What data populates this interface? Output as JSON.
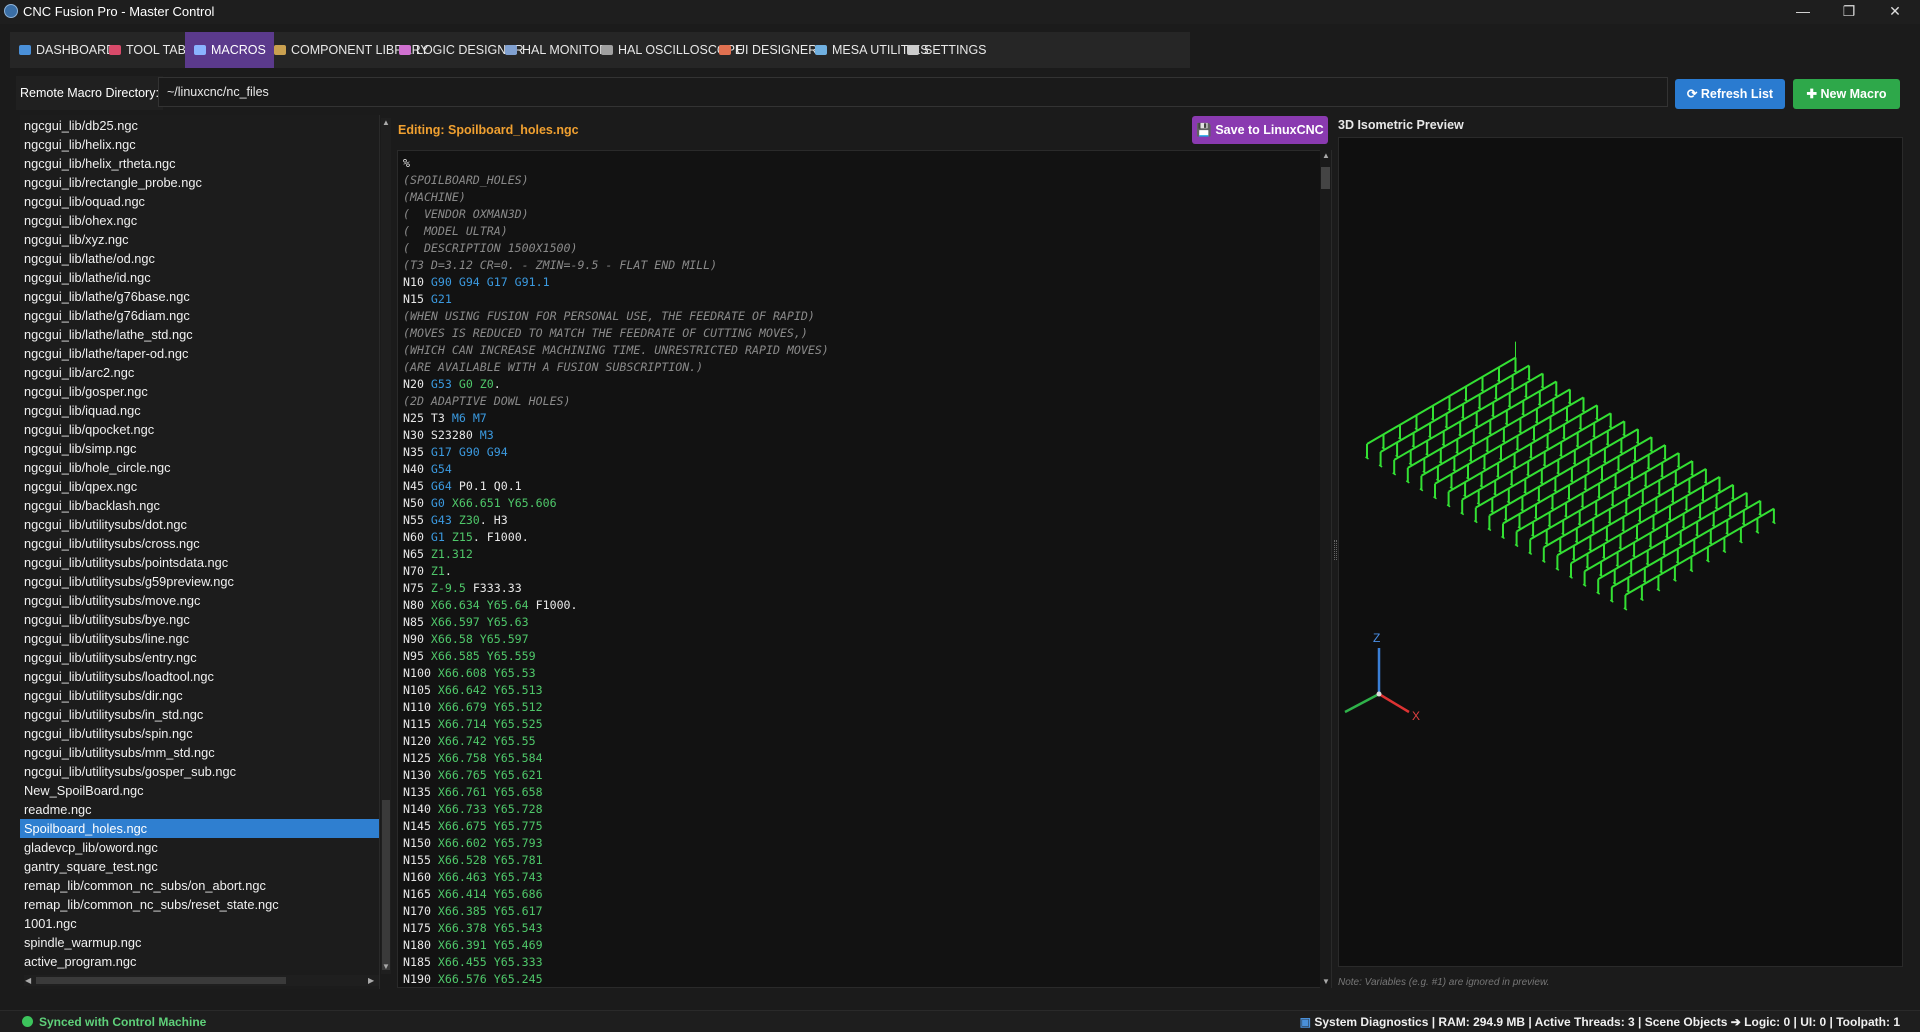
{
  "window": {
    "title": "CNC Fusion Pro - Master Control",
    "minimize": "—",
    "restore": "❐",
    "close": "✕"
  },
  "tabs": [
    {
      "label": "DASHBOARD",
      "icon": "monitor-icon",
      "color": "#4a90d9"
    },
    {
      "label": "TOOL TABLE",
      "icon": "toolbox-icon",
      "color": "#d94a6a"
    },
    {
      "label": "MACROS",
      "icon": "document-icon",
      "color": "#8ab4ff",
      "active": true
    },
    {
      "label": "COMPONENT LIBRARY",
      "icon": "books-icon",
      "color": "#c9a050"
    },
    {
      "label": "LOGIC DESIGNER",
      "icon": "wand-icon",
      "color": "#d070d0"
    },
    {
      "label": "HAL MONITOR",
      "icon": "magnifier-icon",
      "color": "#80a0d0"
    },
    {
      "label": "HAL OSCILLOSCOPE",
      "icon": "chart-icon",
      "color": "#a0a0a0"
    },
    {
      "label": "UI DESIGNER",
      "icon": "palette-icon",
      "color": "#e07050"
    },
    {
      "label": "MESA UTILITIES",
      "icon": "chip-icon",
      "color": "#70b0e0"
    },
    {
      "label": "SETTINGS",
      "icon": "gear-icon",
      "color": "#cccccc"
    }
  ],
  "directory": {
    "label": "Remote Macro Directory:",
    "value": "~/linuxcnc/nc_files",
    "refresh_label": "Refresh List",
    "new_macro_label": "New Macro"
  },
  "files": [
    "ngcgui_lib/db25.ngc",
    "ngcgui_lib/helix.ngc",
    "ngcgui_lib/helix_rtheta.ngc",
    "ngcgui_lib/rectangle_probe.ngc",
    "ngcgui_lib/oquad.ngc",
    "ngcgui_lib/ohex.ngc",
    "ngcgui_lib/xyz.ngc",
    "ngcgui_lib/lathe/od.ngc",
    "ngcgui_lib/lathe/id.ngc",
    "ngcgui_lib/lathe/g76base.ngc",
    "ngcgui_lib/lathe/g76diam.ngc",
    "ngcgui_lib/lathe/lathe_std.ngc",
    "ngcgui_lib/lathe/taper-od.ngc",
    "ngcgui_lib/arc2.ngc",
    "ngcgui_lib/gosper.ngc",
    "ngcgui_lib/iquad.ngc",
    "ngcgui_lib/qpocket.ngc",
    "ngcgui_lib/simp.ngc",
    "ngcgui_lib/hole_circle.ngc",
    "ngcgui_lib/qpex.ngc",
    "ngcgui_lib/backlash.ngc",
    "ngcgui_lib/utilitysubs/dot.ngc",
    "ngcgui_lib/utilitysubs/cross.ngc",
    "ngcgui_lib/utilitysubs/pointsdata.ngc",
    "ngcgui_lib/utilitysubs/g59preview.ngc",
    "ngcgui_lib/utilitysubs/move.ngc",
    "ngcgui_lib/utilitysubs/bye.ngc",
    "ngcgui_lib/utilitysubs/line.ngc",
    "ngcgui_lib/utilitysubs/entry.ngc",
    "ngcgui_lib/utilitysubs/loadtool.ngc",
    "ngcgui_lib/utilitysubs/dir.ngc",
    "ngcgui_lib/utilitysubs/in_std.ngc",
    "ngcgui_lib/utilitysubs/spin.ngc",
    "ngcgui_lib/utilitysubs/mm_std.ngc",
    "ngcgui_lib/utilitysubs/gosper_sub.ngc",
    "New_SpoilBoard.ngc",
    "readme.ngc",
    "Spoilboard_holes.ngc",
    "gladevcp_lib/oword.ngc",
    "gantry_square_test.ngc",
    "remap_lib/common_nc_subs/on_abort.ngc",
    "remap_lib/common_nc_subs/reset_state.ngc",
    "1001.ngc",
    "spindle_warmup.ngc",
    "active_program.ngc"
  ],
  "selected_file": "Spoilboard_holes.ngc",
  "editor": {
    "title": "Editing: Spoilboard_holes.ngc",
    "save_label": "Save to LinuxCNC",
    "lines": [
      [
        [
          "n",
          "%"
        ]
      ],
      [
        [
          "c",
          "(SPOILBOARD_HOLES)"
        ]
      ],
      [
        [
          "c",
          "(MACHINE)"
        ]
      ],
      [
        [
          "c",
          "(  VENDOR OXMAN3D)"
        ]
      ],
      [
        [
          "c",
          "(  MODEL ULTRA)"
        ]
      ],
      [
        [
          "c",
          "(  DESCRIPTION 1500X1500)"
        ]
      ],
      [
        [
          "c",
          "(T3 D=3.12 CR=0. - ZMIN=-9.5 - FLAT END MILL)"
        ]
      ],
      [
        [
          "n",
          "N10 "
        ],
        [
          "g",
          "G90 G94 G17 G91.1"
        ]
      ],
      [
        [
          "n",
          "N15 "
        ],
        [
          "g",
          "G21"
        ]
      ],
      [
        [
          "c",
          "(WHEN USING FUSION FOR PERSONAL USE, THE FEEDRATE OF RAPID)"
        ]
      ],
      [
        [
          "c",
          "(MOVES IS REDUCED TO MATCH THE FEEDRATE OF CUTTING MOVES,)"
        ]
      ],
      [
        [
          "c",
          "(WHICH CAN INCREASE MACHINING TIME. UNRESTRICTED RAPID MOVES)"
        ]
      ],
      [
        [
          "c",
          "(ARE AVAILABLE WITH A FUSION SUBSCRIPTION.)"
        ]
      ],
      [
        [
          "n",
          "N20 "
        ],
        [
          "g",
          "G53 "
        ],
        [
          "x",
          "G0 Z0"
        ],
        [
          "n",
          "."
        ]
      ],
      [
        [
          "c",
          "(2D ADAPTIVE DOWL HOLES)"
        ]
      ],
      [
        [
          "n",
          "N25 T3 "
        ],
        [
          "g",
          "M6 M7"
        ]
      ],
      [
        [
          "n",
          "N30 S23280 "
        ],
        [
          "g",
          "M3"
        ]
      ],
      [
        [
          "n",
          "N35 "
        ],
        [
          "g",
          "G17 G90 G94"
        ]
      ],
      [
        [
          "n",
          "N40 "
        ],
        [
          "g",
          "G54"
        ]
      ],
      [
        [
          "n",
          "N45 "
        ],
        [
          "g",
          "G64 "
        ],
        [
          "n",
          "P0.1 Q0.1"
        ]
      ],
      [
        [
          "n",
          "N50 "
        ],
        [
          "g",
          "G0 "
        ],
        [
          "x",
          "X66.651 Y65.606"
        ]
      ],
      [
        [
          "n",
          "N55 "
        ],
        [
          "g",
          "G43 "
        ],
        [
          "x",
          "Z30"
        ],
        [
          "n",
          ". H3"
        ]
      ],
      [
        [
          "n",
          "N60 "
        ],
        [
          "g",
          "G1 "
        ],
        [
          "x",
          "Z15"
        ],
        [
          "n",
          ". F1000."
        ]
      ],
      [
        [
          "n",
          "N65 "
        ],
        [
          "x",
          "Z1.312"
        ]
      ],
      [
        [
          "n",
          "N70 "
        ],
        [
          "x",
          "Z1"
        ],
        [
          "n",
          "."
        ]
      ],
      [
        [
          "n",
          "N75 "
        ],
        [
          "x",
          "Z-9.5 "
        ],
        [
          "n",
          "F333.33"
        ]
      ],
      [
        [
          "n",
          "N80 "
        ],
        [
          "x",
          "X66.634 Y65.64 "
        ],
        [
          "n",
          "F1000."
        ]
      ],
      [
        [
          "n",
          "N85 "
        ],
        [
          "x",
          "X66.597 Y65.63"
        ]
      ],
      [
        [
          "n",
          "N90 "
        ],
        [
          "x",
          "X66.58 Y65.597"
        ]
      ],
      [
        [
          "n",
          "N95 "
        ],
        [
          "x",
          "X66.585 Y65.559"
        ]
      ],
      [
        [
          "n",
          "N100 "
        ],
        [
          "x",
          "X66.608 Y65.53"
        ]
      ],
      [
        [
          "n",
          "N105 "
        ],
        [
          "x",
          "X66.642 Y65.513"
        ]
      ],
      [
        [
          "n",
          "N110 "
        ],
        [
          "x",
          "X66.679 Y65.512"
        ]
      ],
      [
        [
          "n",
          "N115 "
        ],
        [
          "x",
          "X66.714 Y65.525"
        ]
      ],
      [
        [
          "n",
          "N120 "
        ],
        [
          "x",
          "X66.742 Y65.55"
        ]
      ],
      [
        [
          "n",
          "N125 "
        ],
        [
          "x",
          "X66.758 Y65.584"
        ]
      ],
      [
        [
          "n",
          "N130 "
        ],
        [
          "x",
          "X66.765 Y65.621"
        ]
      ],
      [
        [
          "n",
          "N135 "
        ],
        [
          "x",
          "X66.761 Y65.658"
        ]
      ],
      [
        [
          "n",
          "N140 "
        ],
        [
          "x",
          "X66.733 Y65.728"
        ]
      ],
      [
        [
          "n",
          "N145 "
        ],
        [
          "x",
          "X66.675 Y65.775"
        ]
      ],
      [
        [
          "n",
          "N150 "
        ],
        [
          "x",
          "X66.602 Y65.793"
        ]
      ],
      [
        [
          "n",
          "N155 "
        ],
        [
          "x",
          "X66.528 Y65.781"
        ]
      ],
      [
        [
          "n",
          "N160 "
        ],
        [
          "x",
          "X66.463 Y65.743"
        ]
      ],
      [
        [
          "n",
          "N165 "
        ],
        [
          "x",
          "X66.414 Y65.686"
        ]
      ],
      [
        [
          "n",
          "N170 "
        ],
        [
          "x",
          "X66.385 Y65.617"
        ]
      ],
      [
        [
          "n",
          "N175 "
        ],
        [
          "x",
          "X66.378 Y65.543"
        ]
      ],
      [
        [
          "n",
          "N180 "
        ],
        [
          "x",
          "X66.391 Y65.469"
        ]
      ],
      [
        [
          "n",
          "N185 "
        ],
        [
          "x",
          "X66.455 Y65.333"
        ]
      ],
      [
        [
          "n",
          "N190 "
        ],
        [
          "x",
          "X66.576 Y65.245"
        ]
      ]
    ]
  },
  "preview": {
    "title": "3D Isometric Preview",
    "note": "Note: Variables (e.g. #1) are ignored in preview.",
    "axis_x": "X",
    "axis_z": "Z",
    "toolpath_color": "#33e033",
    "rows": 20,
    "cols": 10
  },
  "status": {
    "sync_text": "Synced with Control Machine",
    "diagnostics": "System Diagnostics  |  RAM: 294.9 MB  |  Active Threads: 3  |  Scene Objects ➔ Logic: 0 | UI: 0 | Toolpath: 1"
  }
}
